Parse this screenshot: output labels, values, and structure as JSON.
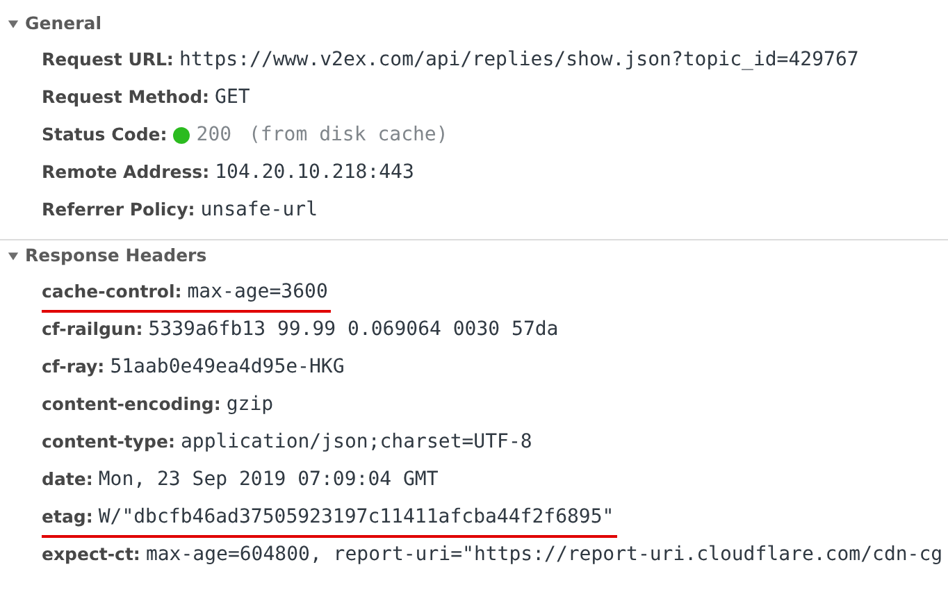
{
  "sections": [
    {
      "title": "General",
      "expanded": true,
      "rows": [
        {
          "kind": "plain",
          "label": "Request URL:",
          "value": "https://www.v2ex.com/api/replies/show.json?topic_id=429767"
        },
        {
          "kind": "plain",
          "label": "Request Method:",
          "value": "GET"
        },
        {
          "kind": "status",
          "label": "Status Code:",
          "color": "#2bbb1f",
          "value": "200",
          "note": "(from disk cache)"
        },
        {
          "kind": "plain",
          "label": "Remote Address:",
          "value": "104.20.10.218:443"
        },
        {
          "kind": "plain",
          "label": "Referrer Policy:",
          "value": "unsafe-url"
        }
      ]
    },
    {
      "title": "Response Headers",
      "expanded": true,
      "rows": [
        {
          "kind": "plain",
          "label": "cache-control:",
          "value": "max-age=3600",
          "underlined": true
        },
        {
          "kind": "plain",
          "label": "cf-railgun:",
          "value": "5339a6fb13 99.99 0.069064 0030 57da",
          "underlined": false
        },
        {
          "kind": "plain",
          "label": "cf-ray:",
          "value": "51aab0e49ea4d95e-HKG",
          "underlined": false
        },
        {
          "kind": "plain",
          "label": "content-encoding:",
          "value": "gzip",
          "underlined": false
        },
        {
          "kind": "plain",
          "label": "content-type:",
          "value": "application/json;charset=UTF-8",
          "underlined": false
        },
        {
          "kind": "plain",
          "label": "date:",
          "value": "Mon, 23 Sep 2019 07:09:04 GMT",
          "underlined": false
        },
        {
          "kind": "plain",
          "label": "etag:",
          "value": "W/\"dbcfb46ad37505923197c11411afcba44f2f6895\"",
          "underlined": true
        },
        {
          "kind": "plain",
          "label": "expect-ct:",
          "value": "max-age=604800, report-uri=\"https://report-uri.cloudflare.com/cdn-cg",
          "underlined": false
        }
      ]
    }
  ]
}
